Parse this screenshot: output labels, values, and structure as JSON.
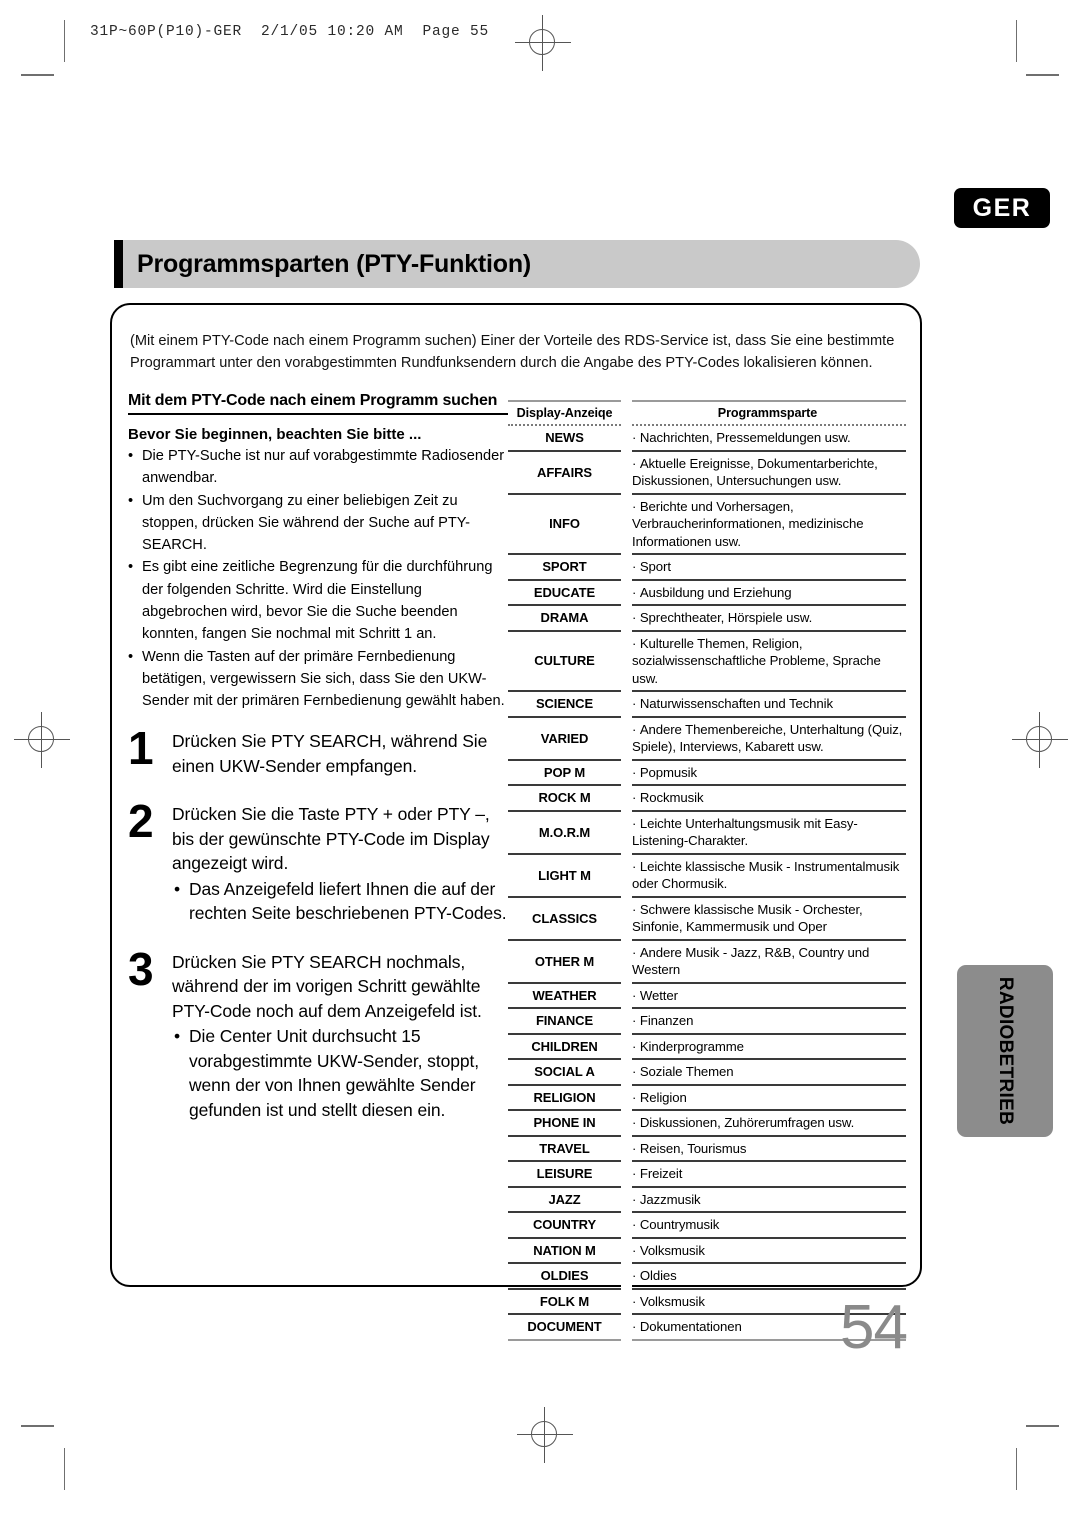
{
  "print_header": "31P~60P(P10)-GER  2/1/05 10:20 AM  Page 55",
  "badge": {
    "language": "GER"
  },
  "title": "Programmsparten (PTY-Funktion)",
  "intro": "(Mit einem PTY-Code nach einem Programm suchen) Einer der Vorteile des RDS-Service ist, dass Sie eine bestimmte Programmart unter den vorabgestimmten Rundfunksendern durch die Angabe des PTY-Codes lokalisieren können.",
  "left_column": {
    "section_heading": "Mit dem PTY-Code nach einem Programm suchen",
    "sub_heading": "Bevor Sie beginnen, beachten Sie bitte ...",
    "notes": [
      "Die PTY-Suche ist nur auf vorabgestimmte Radiosender anwendbar.",
      "Um den Suchvorgang zu einer beliebigen Zeit zu stoppen, drücken Sie während der Suche auf PTY-SEARCH.",
      "Es gibt eine zeitliche Begrenzung für die durchführung der folgenden Schritte. Wird die Einstellung abgebrochen wird, bevor Sie die Suche beenden konnten, fangen Sie nochmal mit Schritt 1 an.",
      "Wenn die Tasten auf der primäre Fernbedienung betätigen, vergewissern Sie sich, dass Sie den UKW-Sender mit der primären Fernbedienung gewählt haben."
    ],
    "steps": [
      {
        "number": "1",
        "text": "Drücken Sie PTY SEARCH, während Sie einen UKW-Sender empfangen.",
        "bullets": []
      },
      {
        "number": "2",
        "text": "Drücken Sie die Taste PTY + oder PTY –, bis der gewünschte PTY-Code im Display angezeigt wird.",
        "bullets": [
          "Das Anzeigefeld liefert Ihnen die auf der rechten Seite beschriebenen PTY-Codes."
        ]
      },
      {
        "number": "3",
        "text": "Drücken Sie PTY SEARCH nochmals, während der im vorigen Schritt gewählte PTY-Code noch auf dem Anzeigefeld ist.",
        "bullets": [
          "Die Center Unit durchsucht 15 vorabgestimmte UKW-Sender, stoppt, wenn der von Ihnen gewählte Sender gefunden ist und stellt diesen ein."
        ]
      }
    ]
  },
  "pty_table": {
    "headers": [
      "Display-Anzeiqe",
      "Programmsparte"
    ],
    "rows": [
      {
        "code": "NEWS",
        "desc": "Nachrichten, Pressemeldungen usw."
      },
      {
        "code": "AFFAIRS",
        "desc": "Aktuelle Ereignisse, Dokumentarberichte, Diskussionen, Untersuchungen usw."
      },
      {
        "code": "INFO",
        "desc": "Berichte und Vorhersagen, Verbraucherinformationen, medizinische Informationen usw."
      },
      {
        "code": "SPORT",
        "desc": "Sport"
      },
      {
        "code": "EDUCATE",
        "desc": "Ausbildung und Erziehung"
      },
      {
        "code": "DRAMA",
        "desc": "Sprechtheater, Hörspiele usw."
      },
      {
        "code": "CULTURE",
        "desc": "Kulturelle Themen, Religion, sozialwissenschaftliche Probleme, Sprache usw."
      },
      {
        "code": "SCIENCE",
        "desc": "Naturwissenschaften und Technik"
      },
      {
        "code": "VARIED",
        "desc": "Andere Themenbereiche, Unterhaltung (Quiz, Spiele), Interviews, Kabarett usw."
      },
      {
        "code": "POP M",
        "desc": "Popmusik"
      },
      {
        "code": "ROCK M",
        "desc": "Rockmusik"
      },
      {
        "code": "M.O.R.M",
        "desc": "Leichte Unterhaltungsmusik mit Easy-Listening-Charakter."
      },
      {
        "code": "LIGHT M",
        "desc": "Leichte klassische Musik -  Instrumentalmusik oder Chormusik."
      },
      {
        "code": "CLASSICS",
        "desc": "Schwere klassische Musik - Orchester, Sinfonie, Kammermusik und Oper"
      },
      {
        "code": "OTHER M",
        "desc": "Andere Musik - Jazz, R&B, Country und Western"
      },
      {
        "code": "WEATHER",
        "desc": "Wetter"
      },
      {
        "code": "FINANCE",
        "desc": "Finanzen"
      },
      {
        "code": "CHILDREN",
        "desc": "Kinderprogramme"
      },
      {
        "code": "SOCIAL A",
        "desc": "Soziale Themen"
      },
      {
        "code": "RELIGION",
        "desc": "Religion"
      },
      {
        "code": "PHONE IN",
        "desc": "Diskussionen, Zuhörerumfragen usw."
      },
      {
        "code": "TRAVEL",
        "desc": "Reisen, Tourismus"
      },
      {
        "code": "LEISURE",
        "desc": "Freizeit"
      },
      {
        "code": "JAZZ",
        "desc": "Jazzmusik"
      },
      {
        "code": "COUNTRY",
        "desc": "Countrymusik"
      },
      {
        "code": "NATION M",
        "desc": "Volksmusik"
      },
      {
        "code": "OLDIES",
        "desc": "Oldies"
      },
      {
        "code": "FOLK M",
        "desc": "Volksmusik"
      },
      {
        "code": "DOCUMENT",
        "desc": "Dokumentationen"
      }
    ]
  },
  "side_tab": "RADIOBETRIEB",
  "page_number": "54"
}
